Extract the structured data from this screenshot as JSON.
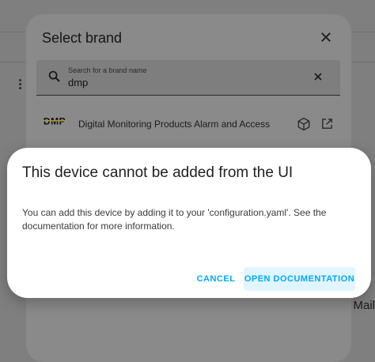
{
  "brand_dialog": {
    "title": "Select brand",
    "search": {
      "label": "Search for a brand name",
      "value": "dmp"
    },
    "results": [
      {
        "logo_text": "DMP",
        "name": "Digital Monitoring Products Alarm and Access"
      }
    ]
  },
  "alert_dialog": {
    "title": "This device cannot be added from the UI",
    "message": "You can add this device by adding it to your 'configuration.yaml'. See the documentation for more information.",
    "cancel_label": "CANCEL",
    "open_docs_label": "OPEN DOCUMENTATION"
  },
  "background": {
    "partial_text": "e Mail"
  },
  "colors": {
    "accent": "#03a9f4",
    "accent_bg": "#e1f5fe",
    "scrim": "#7f7f7f"
  },
  "icons": [
    "close-icon",
    "magnify-icon",
    "cube-icon",
    "open-in-new-icon",
    "dots-vertical-icon"
  ]
}
